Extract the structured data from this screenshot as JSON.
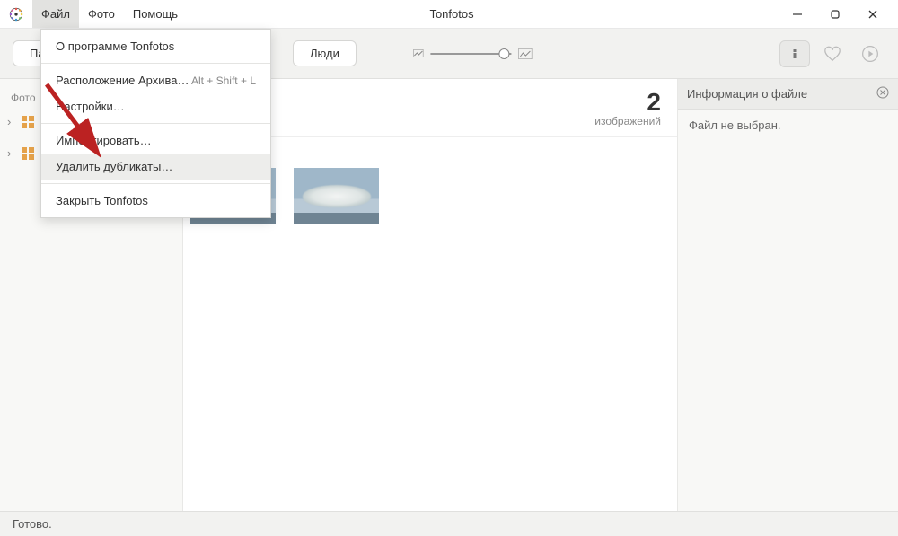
{
  "titlebar": {
    "app_title": "Tonfotos",
    "menu": {
      "file": "Файл",
      "photo": "Фото",
      "help": "Помощь"
    }
  },
  "dropdown": {
    "about": "О программе Tonfotos",
    "archive_location": "Расположение Архива…",
    "archive_shortcut": "Alt + Shift + L",
    "settings": "Настройки…",
    "import": "Импортировать…",
    "remove_dupes": "Удалить дубликаты…",
    "close_app": "Закрыть Tonfotos"
  },
  "toolbar": {
    "tab_folders_truncated": "Па",
    "tab_people": "Люди"
  },
  "sidebar": {
    "heading": "Фото",
    "item1": "Н",
    "item2": "9"
  },
  "content": {
    "count": "2",
    "count_label": "изображений"
  },
  "infopanel": {
    "title": "Информация о файле",
    "empty": "Файл не выбран."
  },
  "statusbar": {
    "text": "Готово."
  }
}
